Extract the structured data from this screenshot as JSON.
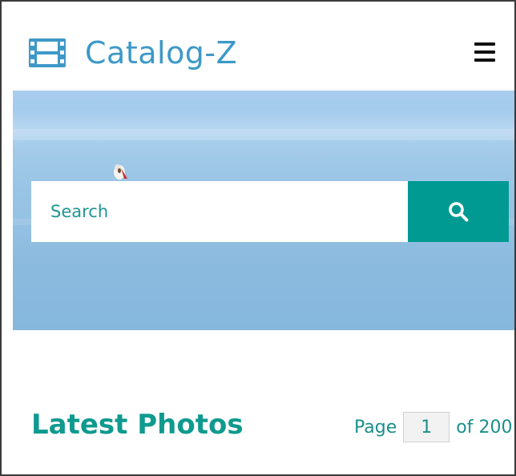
{
  "header": {
    "brand": "Catalog-Z",
    "brand_icon": "film-icon",
    "menu_icon": "hamburger-menu-icon"
  },
  "hero": {
    "search": {
      "placeholder": "Search",
      "button_icon": "search-icon"
    }
  },
  "section": {
    "title": "Latest Photos",
    "pager": {
      "label": "Page",
      "current": "1",
      "suffix": "of 200"
    }
  },
  "colors": {
    "brand": "#3d99c7",
    "accent": "#009a93",
    "title": "#0f9a8f"
  }
}
